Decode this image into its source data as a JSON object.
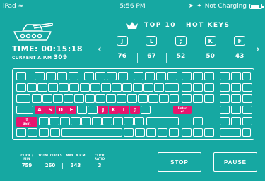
{
  "status_bar": {
    "device": "iPad",
    "wifi_icon": "wifi-icon",
    "time": "5:56 PM",
    "charging": "Not Charging",
    "battery_level": 0.85
  },
  "session": {
    "time_label": "TIME:",
    "time_value": "00:15:18",
    "apm_label": "CURRENT A.P.M",
    "apm_value": "309"
  },
  "hotkeys": {
    "title": "TOP 10   HOT KEYS",
    "crown_icon": "crown-icon",
    "items": [
      {
        "key": "J",
        "count": "76"
      },
      {
        "key": "L",
        "count": "67"
      },
      {
        "key": ";",
        "count": "52"
      },
      {
        "key": "K",
        "count": "50"
      },
      {
        "key": "F",
        "count": "43"
      }
    ]
  },
  "keyboard": {
    "keys": [
      {
        "l": "A",
        "hl": true
      },
      {
        "l": "S",
        "hl": true
      },
      {
        "l": "D",
        "hl": true
      },
      {
        "l": "F",
        "hl": true
      },
      {
        "l": "J",
        "hl": true
      },
      {
        "l": "K",
        "hl": true
      },
      {
        "l": "L",
        "hl": true
      },
      {
        "l": ";",
        "hl": true
      },
      {
        "l": "Enter",
        "hl": true
      },
      {
        "l": "Shift",
        "hl": true
      }
    ]
  },
  "stats": {
    "labels": [
      "CLICK / MIN",
      "TOTAL CLICKS",
      "MAX. A.P.M",
      "CLICK RATIO"
    ],
    "values": [
      "759",
      "260",
      "343",
      "3"
    ]
  },
  "buttons": {
    "stop": "STOP",
    "pause": "PAUSE"
  },
  "colors": {
    "background": "#16a8a2",
    "highlight": "#e8156e"
  }
}
